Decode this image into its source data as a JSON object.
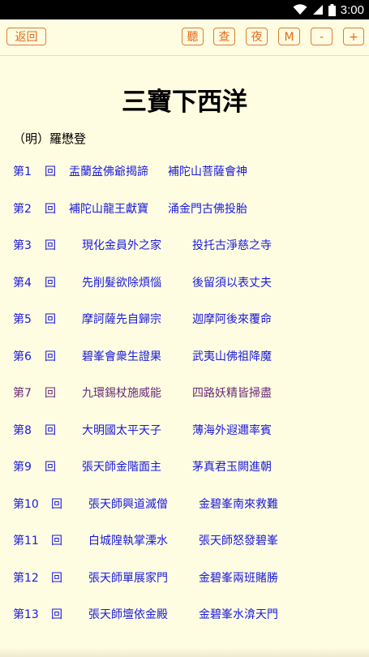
{
  "status": {
    "time": "3:00"
  },
  "toolbar": {
    "back": "返回",
    "listen": "聽",
    "search": "查",
    "night": "夜",
    "menu": "M",
    "font_smaller": "-",
    "font_larger": "+"
  },
  "book": {
    "title": "三寶下西洋",
    "author": "（明）羅懋登"
  },
  "chapters": [
    {
      "num": "第1",
      "hui": "回",
      "t1": "盂蘭盆佛爺揭諦",
      "t2": "補陀山菩薩會神"
    },
    {
      "num": "第2",
      "hui": "回",
      "t1": "補陀山龍王獻寶",
      "t2": "涌金門古佛投胎"
    },
    {
      "num": "第3",
      "hui": "回",
      "t1": "現化金員外之家",
      "t2": "投托古淨慈之寺"
    },
    {
      "num": "第4",
      "hui": "回",
      "t1": "先削髮欲除煩惱",
      "t2": "後留須以表丈夫"
    },
    {
      "num": "第5",
      "hui": "回",
      "t1": "摩訶薩先自歸宗",
      "t2": "迦摩阿後來覆命"
    },
    {
      "num": "第6",
      "hui": "回",
      "t1": "碧峯會衆生證果",
      "t2": "武夷山佛祖降魔"
    },
    {
      "num": "第7",
      "hui": "回",
      "t1": "九環錫杖施威能",
      "t2": "四路妖精皆掃盡"
    },
    {
      "num": "第8",
      "hui": "回",
      "t1": "大明國太平天子",
      "t2": "薄海外遐邇率賓"
    },
    {
      "num": "第9",
      "hui": "回",
      "t1": "張天師金階面主",
      "t2": "茅真君玉闕進朝"
    },
    {
      "num": "第10",
      "hui": "回",
      "t1": "張天師興道滅僧",
      "t2": "金碧峯南來救難"
    },
    {
      "num": "第11",
      "hui": "回",
      "t1": "白城隍執掌溧水",
      "t2": "張天師怒發碧峯"
    },
    {
      "num": "第12",
      "hui": "回",
      "t1": "張天師單展家門",
      "t2": "金碧峯兩班賭勝"
    },
    {
      "num": "第13",
      "hui": "回",
      "t1": "張天師壇依金殿",
      "t2": "金碧峯水渰天門"
    }
  ]
}
